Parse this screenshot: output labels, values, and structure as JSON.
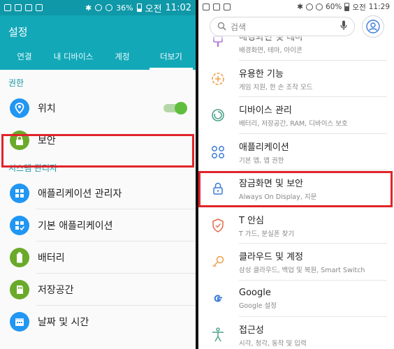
{
  "left": {
    "status": {
      "battery": "36%",
      "ampm": "오전",
      "time": "11:02"
    },
    "title": "설정",
    "tabs": [
      "연결",
      "내 디바이스",
      "계정",
      "더보기"
    ],
    "sections": [
      {
        "header": "권한",
        "items": [
          {
            "label": "위치",
            "toggle": "on"
          },
          {
            "label": "보안"
          }
        ]
      },
      {
        "header": "시스템 관리자",
        "items": [
          {
            "label": "애플리케이션 관리자"
          },
          {
            "label": "기본 애플리케이션"
          },
          {
            "label": "배터리"
          },
          {
            "label": "저장공간"
          },
          {
            "label": "날짜 및 시간"
          }
        ]
      }
    ],
    "colors": {
      "statusbar": "#0f98a8",
      "appbar": "#12a8b8",
      "blue_icon": "#2196f3",
      "green_icon": "#6aaa2a",
      "highlight": "#e0242a"
    }
  },
  "right": {
    "status": {
      "battery": "60%",
      "ampm": "오전",
      "time": "11:29"
    },
    "search": {
      "placeholder": "검색"
    },
    "items": [
      {
        "title": "배경화면 및 테마",
        "subtitle": "배경화면, 테마, 아이콘",
        "icon": "paintbrush-icon"
      },
      {
        "title": "유용한 기능",
        "subtitle": "게임 지원, 한 손 조작 모드",
        "icon": "plus-gear-icon"
      },
      {
        "title": "디바이스 관리",
        "subtitle": "배터리, 저장공간, RAM, 디바이스 보호",
        "icon": "refresh-icon"
      },
      {
        "title": "애플리케이션",
        "subtitle": "기본 앱, 앱 권한",
        "icon": "apps-grid-icon"
      },
      {
        "title": "잠금화면 및 보안",
        "subtitle": "Always On Display, 지문",
        "icon": "lock-icon"
      },
      {
        "title": "T 안심",
        "subtitle": "T 가드, 분실폰 찾기",
        "icon": "shield-icon"
      },
      {
        "title": "클라우드 및 계정",
        "subtitle": "삼성 클라우드, 백업 및 복원, Smart Switch",
        "icon": "key-icon"
      },
      {
        "title": "Google",
        "subtitle": "Google 설정",
        "icon": "google-icon"
      },
      {
        "title": "접근성",
        "subtitle": "시각, 청각, 동작 및 입력",
        "icon": "accessibility-icon"
      }
    ],
    "colors": {
      "icon_orange": "#f0a04b",
      "icon_green": "#4aa08a",
      "icon_blue": "#3c7bd8"
    }
  }
}
